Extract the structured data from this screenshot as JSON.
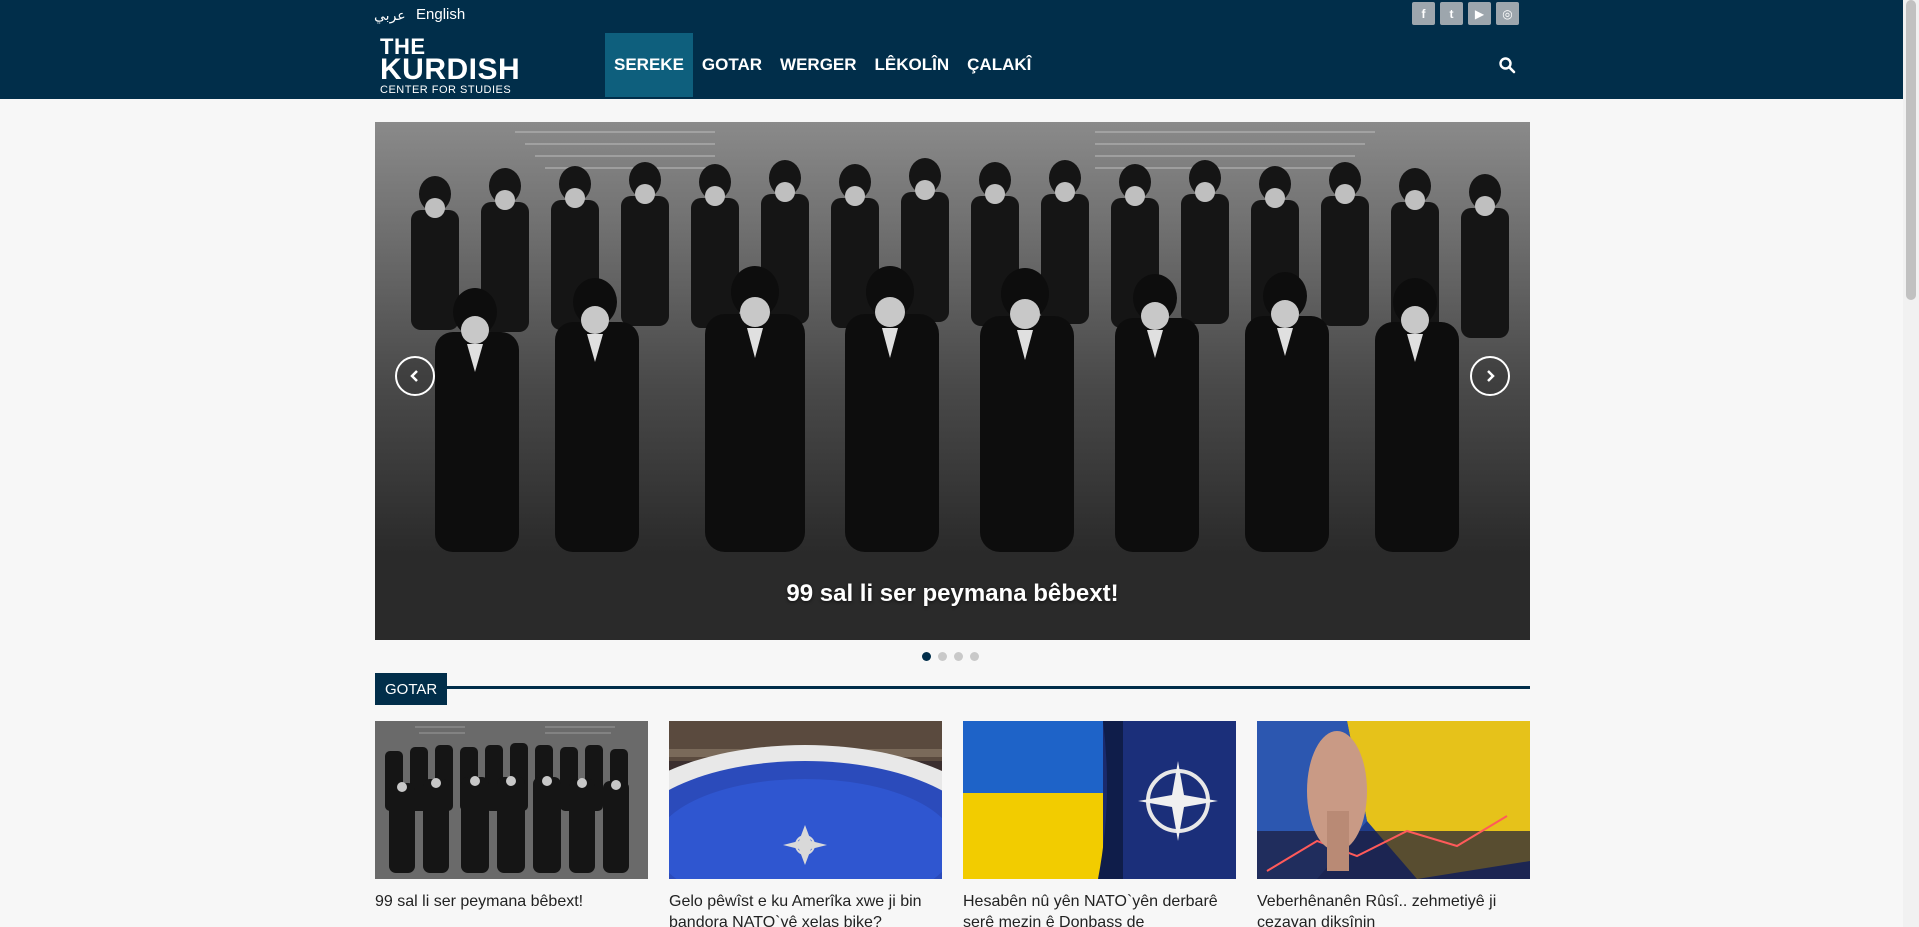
{
  "top": {
    "lang_ar": "عربي",
    "lang_en": "English",
    "social": [
      "f",
      "t",
      "▶",
      "◎"
    ]
  },
  "logo": {
    "line1": "THE",
    "line2": "KURDISH",
    "line3": "CENTER FOR STUDIES"
  },
  "nav": {
    "items": [
      "SEREKE",
      "GOTAR",
      "WERGER",
      "LÊKOLÎN",
      "ÇALAKÎ"
    ],
    "active_index": 0
  },
  "slider": {
    "caption": "99 sal li ser peymana bêbext!",
    "slide_count": 4,
    "active_slide": 1
  },
  "section": {
    "title": "GOTAR"
  },
  "cards": [
    {
      "title": "99 sal li ser peymana bêbext!"
    },
    {
      "title": "Gelo pêwîst e ku Amerîka xwe ji bin bandora NATO`yê xelas bike?"
    },
    {
      "title": "Hesabên nû yên NATO`yên derbarê şerê mezin ê Donbass de"
    },
    {
      "title": "Veberhênanên Rûsî.. zehmetiyê ji cezayan dikşînin"
    }
  ],
  "colors": {
    "navy": "#012e4a",
    "active_nav": "#0e5f7d",
    "ukraine_blue": "#0057b7",
    "ukraine_yellow": "#ffd700"
  }
}
